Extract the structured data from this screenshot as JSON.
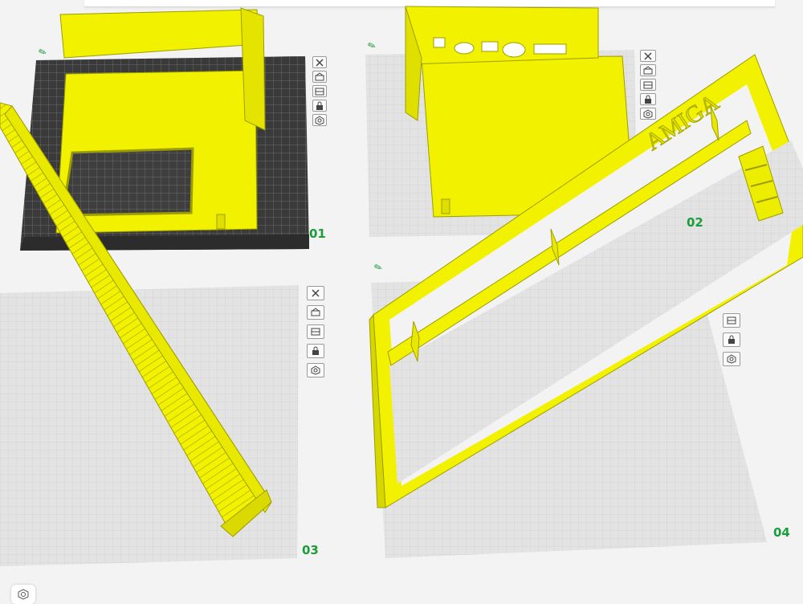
{
  "plates": [
    {
      "id": "plate-01",
      "label": "01"
    },
    {
      "id": "plate-02",
      "label": "02"
    },
    {
      "id": "plate-03",
      "label": "03"
    },
    {
      "id": "plate-04",
      "label": "04"
    }
  ],
  "plate_tools": [
    "close-icon",
    "auto-orient-icon",
    "arrange-icon",
    "lock-icon",
    "settings-icon"
  ],
  "model_text": "AMIGA",
  "colors": {
    "filament": "#f2f200",
    "filament_shadow": "#b7b700",
    "plate_gray": "#e2e2e2",
    "grid": "#d0d0d0",
    "active_plate": "#3a3a3a",
    "label_green": "#1a9d3a"
  }
}
